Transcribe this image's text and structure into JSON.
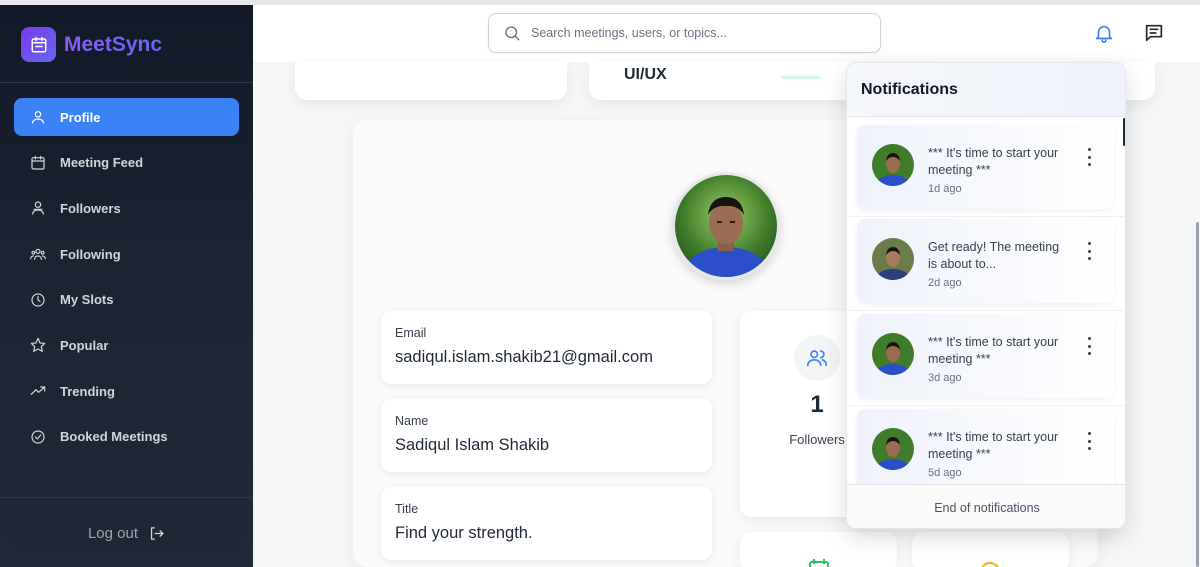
{
  "app": {
    "name": "MeetSync"
  },
  "sidebar": {
    "items": [
      {
        "label": "Profile",
        "icon": "user-icon",
        "active": true
      },
      {
        "label": "Meeting Feed",
        "icon": "calendar-icon",
        "active": false
      },
      {
        "label": "Followers",
        "icon": "users-icon",
        "active": false
      },
      {
        "label": "Following",
        "icon": "group-icon",
        "active": false
      },
      {
        "label": "My Slots",
        "icon": "clock-icon",
        "active": false
      },
      {
        "label": "Popular",
        "icon": "star-icon",
        "active": false
      },
      {
        "label": "Trending",
        "icon": "trending-icon",
        "active": false
      },
      {
        "label": "Booked Meetings",
        "icon": "check-circle-icon",
        "active": false
      }
    ],
    "logout_label": "Log out"
  },
  "header": {
    "search_placeholder": "Search meetings, users, or topics..."
  },
  "top_cards": {
    "second_label": "UI/UX"
  },
  "profile": {
    "fields": [
      {
        "label": "Email",
        "value": "sadiqul.islam.shakib21@gmail.com"
      },
      {
        "label": "Name",
        "value": "Sadiqul Islam Shakib"
      },
      {
        "label": "Title",
        "value": "Find your strength."
      }
    ],
    "stats": {
      "followers_count": "1",
      "followers_label": "Followers"
    }
  },
  "notifications": {
    "title": "Notifications",
    "items": [
      {
        "text": "*** It's time to start your meeting ***",
        "time": "1d ago"
      },
      {
        "text": "Get ready! The meeting is about to...",
        "time": "2d ago"
      },
      {
        "text": "*** It's time to start your meeting ***",
        "time": "3d ago"
      },
      {
        "text": "*** It's time to start your meeting ***",
        "time": "5d ago"
      }
    ],
    "footer": "End of notifications"
  },
  "colors": {
    "accent": "#3b82f6",
    "sidebar_bg": "#111827",
    "brand": "#8b5cf6"
  }
}
